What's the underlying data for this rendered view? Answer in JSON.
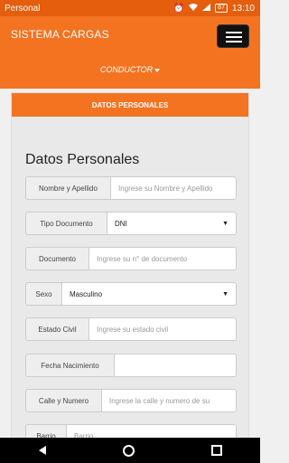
{
  "status": {
    "carrier": "Personal",
    "battery": "87",
    "time": "13:10"
  },
  "header": {
    "brand": "SISTEMA CARGAS",
    "user": "CONDUCTOR"
  },
  "panel": {
    "heading": "DATOS PERSONALES",
    "title": "Datos Personales"
  },
  "form": {
    "nombre": {
      "label": "Nombre y Apellido",
      "placeholder": "Ingrese su Nombre y Apellido"
    },
    "tipo_doc": {
      "label": "Tipo Documento",
      "value": "DNI"
    },
    "documento": {
      "label": "Documento",
      "placeholder": "Ingrese su n° de documento"
    },
    "sexo": {
      "label": "Sexo",
      "value": "Masculino"
    },
    "estado_civil": {
      "label": "Estado Civil",
      "placeholder": "Ingrese su estado civil"
    },
    "fecha_nac": {
      "label": "Fecha Nacimiento",
      "placeholder": ""
    },
    "calle": {
      "label": "Calle y Numero",
      "placeholder": "Ingrese la calle y numero de su"
    },
    "barrio": {
      "label": "Barrio",
      "placeholder": "Barrio"
    }
  },
  "icons": {
    "alarm": "alarm-icon",
    "wifi": "wifi-icon",
    "signal": "signal-icon",
    "battery": "battery-icon"
  }
}
